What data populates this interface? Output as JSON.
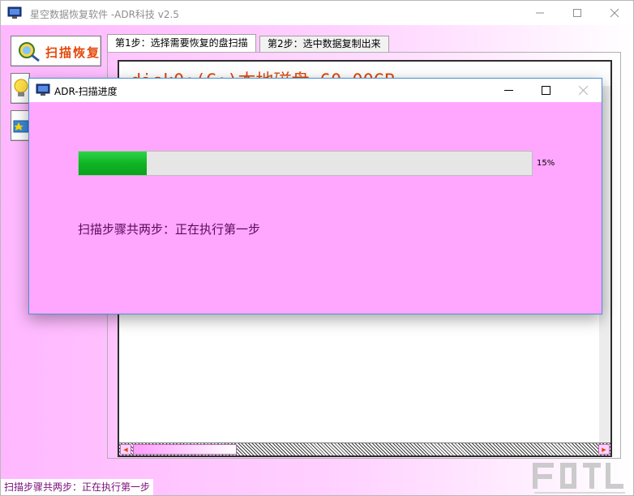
{
  "window": {
    "title": "星空数据恢复软件    -ADR科技 v2.5"
  },
  "toolbar": {
    "scan_recover_label": "扫描恢复"
  },
  "tabs": [
    {
      "label": "第1步：选择需要恢复的盘扫描",
      "active": true
    },
    {
      "label": "第2步：选中数据复制出来",
      "active": false
    }
  ],
  "disk_list": {
    "items": [
      "disk0:(C:)本地磁盘 60.00GB"
    ]
  },
  "dialog": {
    "title": "ADR-扫描进度",
    "progress": {
      "value": 15,
      "text": "15%"
    },
    "message": "扫描步骤共两步：正在执行第一步"
  },
  "statusbar": {
    "text": "扫描步骤共两步：正在执行第一步"
  },
  "colors": {
    "accent_progress": "#0fb524",
    "dialog_bg": "#ffa7ff",
    "label_orange": "#e4480a"
  }
}
